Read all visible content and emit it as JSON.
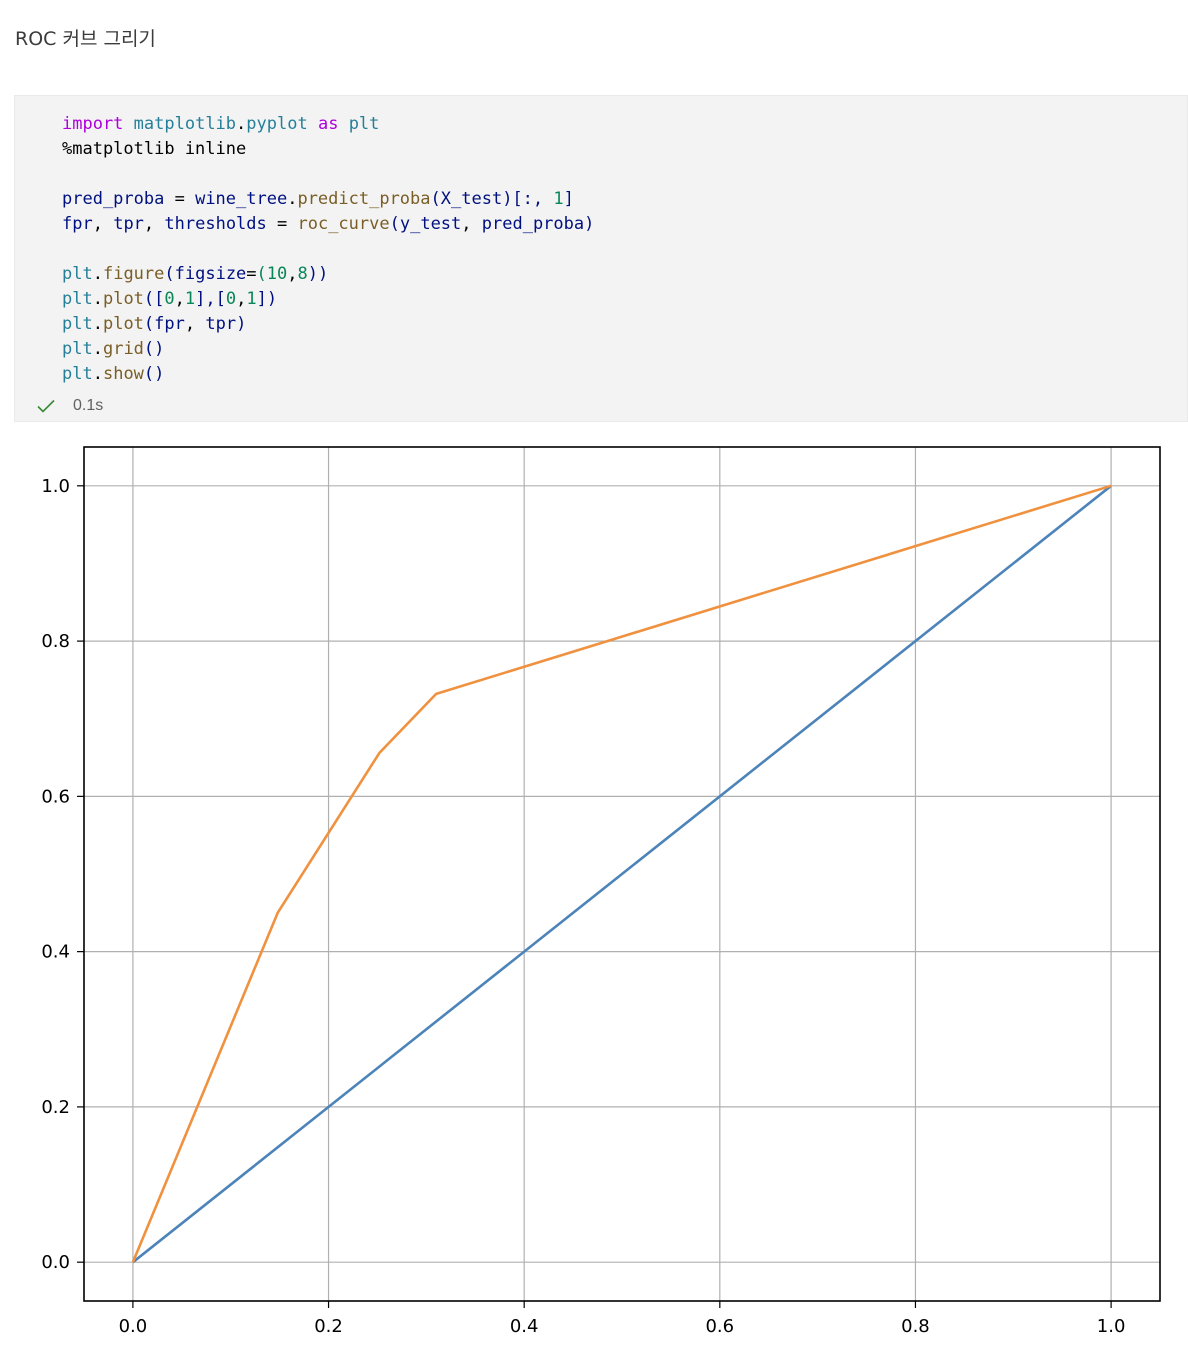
{
  "heading": "ROC 커브 그리기",
  "code_lines": [
    [
      {
        "t": "import",
        "c": "kw"
      },
      {
        "t": " ",
        "c": "pl"
      },
      {
        "t": "matplotlib",
        "c": "mod"
      },
      {
        "t": ".",
        "c": "pl"
      },
      {
        "t": "pyplot",
        "c": "mod"
      },
      {
        "t": " ",
        "c": "pl"
      },
      {
        "t": "as",
        "c": "kw"
      },
      {
        "t": " ",
        "c": "pl"
      },
      {
        "t": "plt",
        "c": "mod"
      }
    ],
    [
      {
        "t": "%matplotlib inline",
        "c": "pl"
      }
    ],
    [],
    [
      {
        "t": "pred_proba",
        "c": "var"
      },
      {
        "t": " = ",
        "c": "pl"
      },
      {
        "t": "wine_tree",
        "c": "var"
      },
      {
        "t": ".",
        "c": "pl"
      },
      {
        "t": "predict_proba",
        "c": "fn"
      },
      {
        "t": "(",
        "c": "var"
      },
      {
        "t": "X_test",
        "c": "var"
      },
      {
        "t": ")[:, ",
        "c": "var"
      },
      {
        "t": "1",
        "c": "num"
      },
      {
        "t": "]",
        "c": "var"
      }
    ],
    [
      {
        "t": "fpr",
        "c": "var"
      },
      {
        "t": ", ",
        "c": "pl"
      },
      {
        "t": "tpr",
        "c": "var"
      },
      {
        "t": ", ",
        "c": "pl"
      },
      {
        "t": "thresholds",
        "c": "var"
      },
      {
        "t": " = ",
        "c": "pl"
      },
      {
        "t": "roc_curve",
        "c": "fn"
      },
      {
        "t": "(",
        "c": "var"
      },
      {
        "t": "y_test",
        "c": "var"
      },
      {
        "t": ", ",
        "c": "pl"
      },
      {
        "t": "pred_proba",
        "c": "var"
      },
      {
        "t": ")",
        "c": "var"
      }
    ],
    [],
    [
      {
        "t": "plt",
        "c": "mod"
      },
      {
        "t": ".",
        "c": "pl"
      },
      {
        "t": "figure",
        "c": "fn"
      },
      {
        "t": "(",
        "c": "var"
      },
      {
        "t": "figsize",
        "c": "var"
      },
      {
        "t": "=",
        "c": "pl"
      },
      {
        "t": "(",
        "c": "num"
      },
      {
        "t": "10",
        "c": "num"
      },
      {
        "t": ",",
        "c": "pl"
      },
      {
        "t": "8",
        "c": "num"
      },
      {
        "t": "))",
        "c": "var"
      }
    ],
    [
      {
        "t": "plt",
        "c": "mod"
      },
      {
        "t": ".",
        "c": "pl"
      },
      {
        "t": "plot",
        "c": "fn"
      },
      {
        "t": "([",
        "c": "var"
      },
      {
        "t": "0",
        "c": "num"
      },
      {
        "t": ",",
        "c": "pl"
      },
      {
        "t": "1",
        "c": "num"
      },
      {
        "t": "],[",
        "c": "var"
      },
      {
        "t": "0",
        "c": "num"
      },
      {
        "t": ",",
        "c": "pl"
      },
      {
        "t": "1",
        "c": "num"
      },
      {
        "t": "])",
        "c": "var"
      }
    ],
    [
      {
        "t": "plt",
        "c": "mod"
      },
      {
        "t": ".",
        "c": "pl"
      },
      {
        "t": "plot",
        "c": "fn"
      },
      {
        "t": "(",
        "c": "var"
      },
      {
        "t": "fpr",
        "c": "var"
      },
      {
        "t": ", ",
        "c": "pl"
      },
      {
        "t": "tpr",
        "c": "var"
      },
      {
        "t": ")",
        "c": "var"
      }
    ],
    [
      {
        "t": "plt",
        "c": "mod"
      },
      {
        "t": ".",
        "c": "pl"
      },
      {
        "t": "grid",
        "c": "fn"
      },
      {
        "t": "()",
        "c": "var"
      }
    ],
    [
      {
        "t": "plt",
        "c": "mod"
      },
      {
        "t": ".",
        "c": "pl"
      },
      {
        "t": "show",
        "c": "fn"
      },
      {
        "t": "()",
        "c": "var"
      }
    ]
  ],
  "status": {
    "time": "0.1s",
    "icon": "check-icon",
    "icon_color": "#388a34"
  },
  "chart_data": {
    "type": "line",
    "title": "",
    "xlabel": "",
    "ylabel": "",
    "xlim": [
      -0.05,
      1.05
    ],
    "ylim": [
      -0.05,
      1.05
    ],
    "grid": true,
    "xticks": [
      0.0,
      0.2,
      0.4,
      0.6,
      0.8,
      1.0
    ],
    "yticks": [
      0.0,
      0.2,
      0.4,
      0.6,
      0.8,
      1.0
    ],
    "xtick_labels": [
      "0.0",
      "0.2",
      "0.4",
      "0.6",
      "0.8",
      "1.0"
    ],
    "ytick_labels": [
      "0.0",
      "0.2",
      "0.4",
      "0.6",
      "0.8",
      "1.0"
    ],
    "series": [
      {
        "color": "#4c83b9",
        "x": [
          0,
          1
        ],
        "y": [
          0,
          1
        ]
      },
      {
        "color": "#f0913f",
        "x": [
          0,
          0.148,
          0.252,
          0.31,
          1.0
        ],
        "y": [
          0,
          0.45,
          0.656,
          0.732,
          1.0
        ]
      }
    ]
  }
}
